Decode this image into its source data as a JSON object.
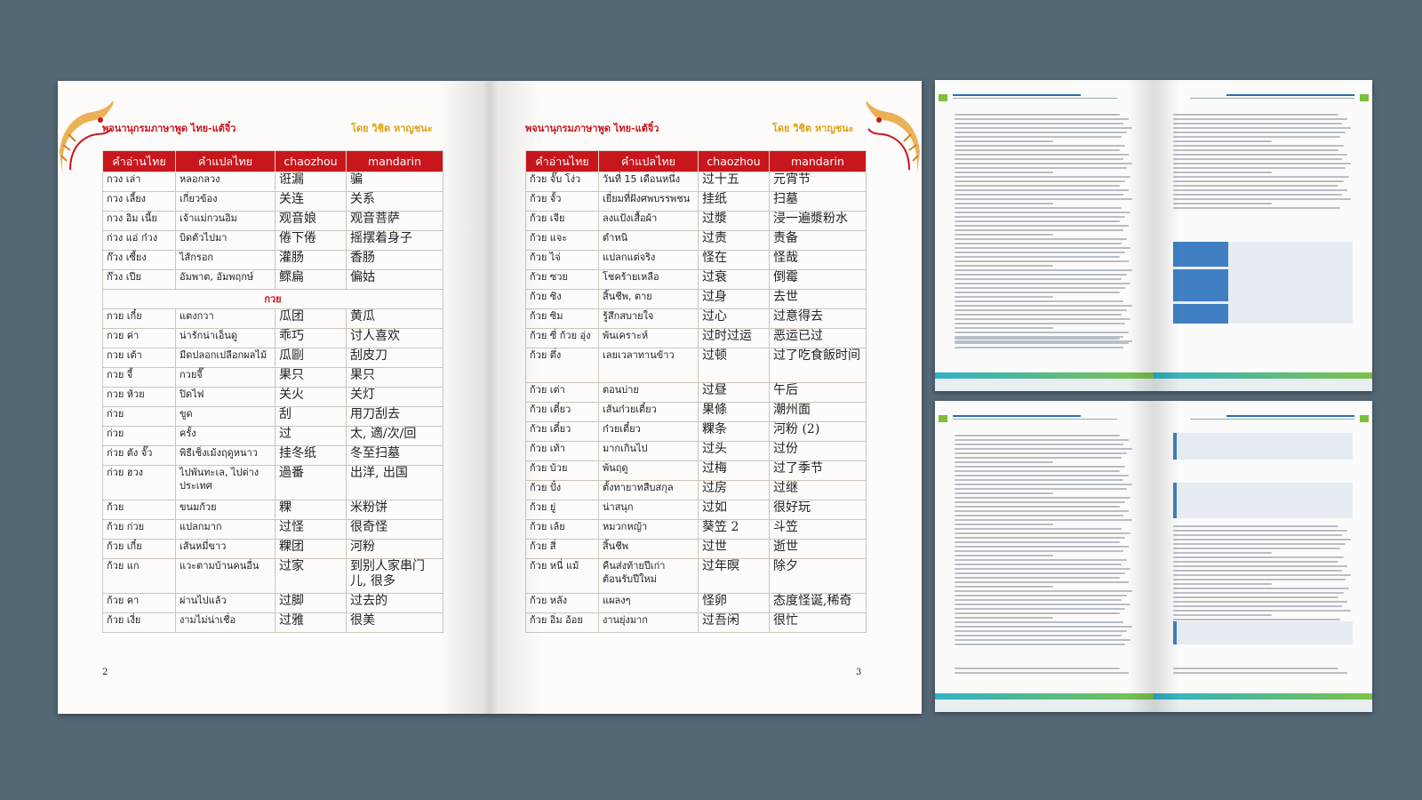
{
  "book": {
    "header_title": "พจนานุกรมภาษาพูด ไทย-แต้จิ๋ว",
    "header_author": "โดย วิชิต หาญชนะ",
    "columns": [
      "คำอ่านไทย",
      "คำแปลไทย",
      "chaozhou",
      "mandarin"
    ],
    "left_page": {
      "page_number": "2",
      "rows": [
        {
          "th": "กวง เล่า",
          "tr": "หลอกลวง",
          "cz": "诳漏",
          "md": "骗"
        },
        {
          "th": "กวง เลี้ยง",
          "tr": "เกี่ยวข้อง",
          "cz": "关连",
          "md": "关系"
        },
        {
          "th": "กวง อิม เนี้ย",
          "tr": "เจ้าแม่กวนอิม",
          "cz": "观音娘",
          "md": "观音菩萨"
        },
        {
          "th": "ก่วง แอ่ ก๋วง",
          "tr": "บิดตัวไปมา",
          "cz": "倦下倦",
          "md": "摇摆着身子"
        },
        {
          "th": "ก๊วง เซี้ยง",
          "tr": "ไส้กรอก",
          "cz": "灌肠",
          "md": "香肠"
        },
        {
          "th": "ก๊วง เปีย",
          "tr": "อัมพาต, อัมพฤกษ์",
          "cz": "鳏扁",
          "md": "偏姑"
        },
        {
          "section": "กวย"
        },
        {
          "th": "กวย เกี๋ย",
          "tr": "แตงกวา",
          "cz": "瓜团",
          "md": "黄瓜"
        },
        {
          "th": "กวย ค่า",
          "tr": "น่ารักน่าเอ็นดู",
          "cz": "乖巧",
          "md": "讨人喜欢"
        },
        {
          "th": "กวย เต้า",
          "tr": "มีดปลอกเปลือกผลไม้",
          "cz": "瓜剾",
          "md": "刮皮刀"
        },
        {
          "th": "กวย จี้",
          "tr": "กวยจี๊",
          "cz": "果只",
          "md": "果只"
        },
        {
          "th": "กวย ห้วย",
          "tr": "ปิดไฟ",
          "cz": "关火",
          "md": "关灯"
        },
        {
          "th": "ก่วย",
          "tr": "ขูด",
          "cz": "刮",
          "md": "用刀刮去"
        },
        {
          "th": "ก่วย",
          "tr": "ครั้ง",
          "cz": "过",
          "md": "太, 適/次/回"
        },
        {
          "th": "ก่วย ตัง จั๊ว",
          "tr": "พิธีเช็งเม้งฤดูหนาว",
          "cz": "挂冬纸",
          "md": "冬至扫墓"
        },
        {
          "th": "ก่วย ฮวง",
          "tr": "ไปพันทะเล, ไปต่างประเทศ",
          "cz": "過番",
          "md": "出洋, 出国",
          "tall": true
        },
        {
          "th": "ก้วย",
          "tr": "ขนมก้วย",
          "cz": "粿",
          "md": "米粉饼"
        },
        {
          "th": "ก้วย ก่วย",
          "tr": "แปลกมาก",
          "cz": "过怪",
          "md": "很奇怪"
        },
        {
          "th": "ก้วย เกี๋ย",
          "tr": "เส้นหมี่ขาว",
          "cz": "粿团",
          "md": "河粉"
        },
        {
          "th": "ก้วย แก",
          "tr": "แวะตามบ้านคนอื่น",
          "cz": "过家",
          "md": "到别人家串门儿, 很多",
          "tall": true
        },
        {
          "th": "ก้วย คา",
          "tr": "ผ่านไปแล้ว",
          "cz": "过脚",
          "md": "过去的"
        },
        {
          "th": "ก้วย เงี่ย",
          "tr": "งามไม่น่าเชื่อ",
          "cz": "过雅",
          "md": "很美"
        }
      ]
    },
    "right_page": {
      "page_number": "3",
      "rows": [
        {
          "th": "ก้วย จั๊บ โง่ว",
          "tr": "วันที่ 15 เดือนหนึ่ง",
          "cz": "过十五",
          "md": "元宵节"
        },
        {
          "th": "ก้วย จั้ว",
          "tr": "เยี่ยมที่ฝังศพบรรพชน",
          "cz": "挂纸",
          "md": "扫墓"
        },
        {
          "th": "ก้วย เจีย",
          "tr": "ลงแป้งเสื้อผ้า",
          "cz": "过漿",
          "md": "浸一遍漿粉水"
        },
        {
          "th": "ก้วย แจะ",
          "tr": "ตำหนิ",
          "cz": "过责",
          "md": "责备"
        },
        {
          "th": "ก้วย ไจ่",
          "tr": "แปลกแต่จริง",
          "cz": "怪在",
          "md": "怪哉"
        },
        {
          "th": "ก้วย ซวย",
          "tr": "โชคร้ายเหลือ",
          "cz": "过衰",
          "md": "倒霉"
        },
        {
          "th": "ก้วย ซิง",
          "tr": "สิ้นชีพ, ตาย",
          "cz": "过身",
          "md": "去世"
        },
        {
          "th": "ก้วย ซิม",
          "tr": "รู้สึกสบายใจ",
          "cz": "过心",
          "md": "过意得去"
        },
        {
          "th": "ก้วย ซี่ ก้วย อุ่ง",
          "tr": "พ้นเคราะห์",
          "cz": "过时过运",
          "md": "恶运已过"
        },
        {
          "th": "ก้วย ตึ่ง",
          "tr": "เลยเวลาทานข้าว",
          "cz": "过顿",
          "md": "过了吃食飯时间",
          "tall": true
        },
        {
          "th": "ก้วย เต่า",
          "tr": "ตอนบ่าย",
          "cz": "过昼",
          "md": "午后"
        },
        {
          "th": "ก้วย เตี๋ยว",
          "tr": "เส้นก๋วยเตี๋ยว",
          "cz": "果條",
          "md": "潮州面"
        },
        {
          "th": "ก้วย เตี๋ยว",
          "tr": "ก๋วยเตี๋ยว",
          "cz": "粿条",
          "md": "河粉 (2)"
        },
        {
          "th": "ก้วย เท้า",
          "tr": "มากเกินไป",
          "cz": "过头",
          "md": "过份"
        },
        {
          "th": "ก้วย บ้วย",
          "tr": "พ้นฤดู",
          "cz": "过梅",
          "md": "过了季节"
        },
        {
          "th": "ก้วย ปั๋ง",
          "tr": "ตั้งทายาทสืบสกุล",
          "cz": "过房",
          "md": "过继"
        },
        {
          "th": "ก้วย ยู่",
          "tr": "น่าสนุก",
          "cz": "过如",
          "md": "很好玩"
        },
        {
          "th": "ก้วย เล้ย",
          "tr": "หมวกหญ้า",
          "cz": "葵笠 2",
          "md": "斗笠"
        },
        {
          "th": "ก้วย สี่",
          "tr": "สิ้นชีพ",
          "cz": "过世",
          "md": "逝世"
        },
        {
          "th": "ก้วย หนี่ แม้",
          "tr": "คืนส่งท้ายปีเก่าต้อนรับปีใหม่",
          "cz": "过年暝",
          "md": "除夕",
          "tall": true
        },
        {
          "th": "ก้วย หลัง",
          "tr": "แผลงๆ",
          "cz": "怪卵",
          "md": "态度怪诞,稀奇"
        },
        {
          "th": "ก้วย อิ่ม อ้อย",
          "tr": "งานยุ่งมาก",
          "cz": "过吾闲",
          "md": "很忙"
        }
      ]
    }
  },
  "colors": {
    "header_red": "#c8161d",
    "author_gold": "#e0a21b",
    "background": "#546774",
    "report_blue": "#3f7fc2",
    "report_green": "#7cbf3a",
    "report_teal": "#32b1c9"
  },
  "icons": [
    "dragon-ornament-icon"
  ]
}
